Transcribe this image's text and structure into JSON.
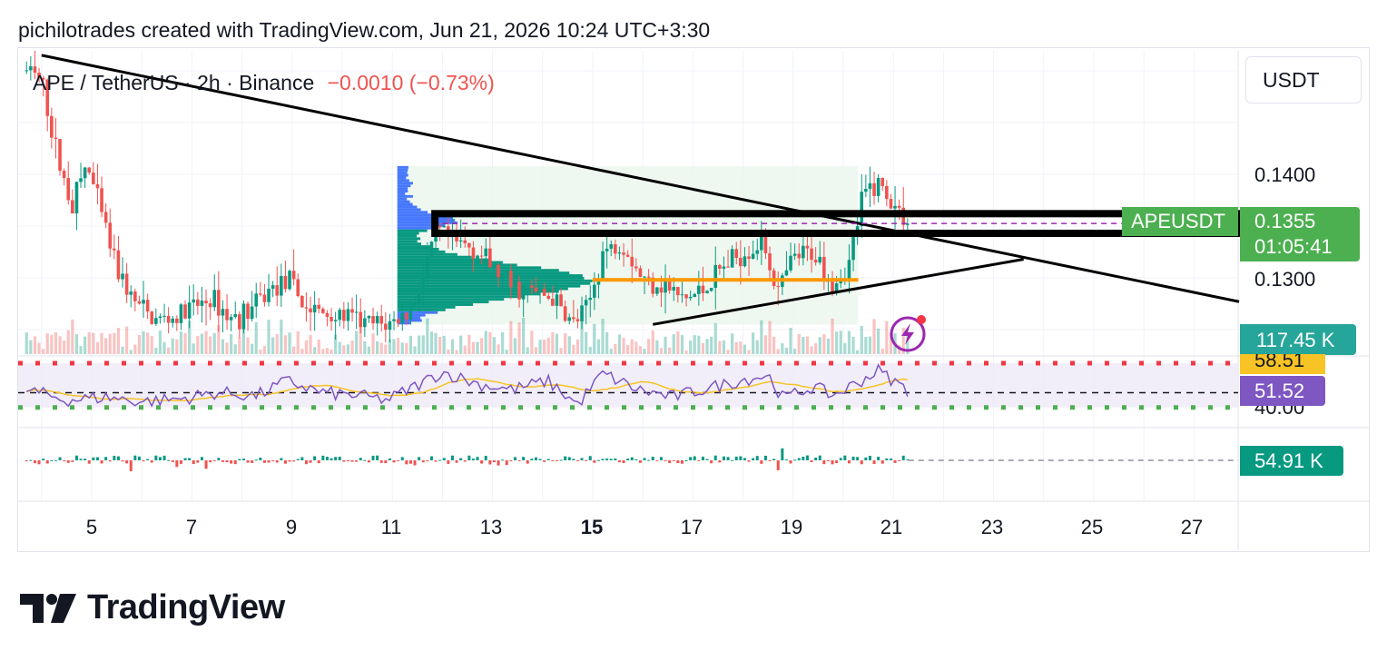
{
  "attribution": "pichilotrades created with TradingView.com, Jun 21, 2026 10:24 UTC+3:30",
  "header": {
    "symbol": "APE / TetherUS · 2h · Binance",
    "change": "−0.0010 (−0.73%)",
    "currency": "USDT"
  },
  "price_axis": {
    "ticks": [
      "0.1400",
      "0.1300"
    ]
  },
  "tags": {
    "ticker_label": "APEUSDT",
    "last_price": "0.1355",
    "countdown": "01:05:41",
    "volume": "117.45 K",
    "rsi_ma": "58.51",
    "rsi": "51.52",
    "rsi_level": "40.00",
    "oscillator": "54.91 K"
  },
  "x_axis": {
    "labels": [
      "5",
      "7",
      "9",
      "11",
      "13",
      "15",
      "17",
      "19",
      "21",
      "23",
      "25",
      "27"
    ],
    "bold_label": "15"
  },
  "logo_text": "TradingView",
  "colors": {
    "up": "#089981",
    "down": "#ef5350",
    "rsi_line": "#7e57c2",
    "rsi_ma": "#f7c325",
    "profile_blue": "#2962ff",
    "profile_green": "#089981",
    "poc_orange": "#ff9800",
    "last_price_tag": "#4caf50",
    "volume_tag": "#26a69a"
  },
  "chart_data": {
    "type": "candlestick",
    "symbol": "APE / TetherUS",
    "interval": "2h",
    "exchange": "Binance",
    "price_range": [
      0.1245,
      0.1515
    ],
    "last_price": 0.1355,
    "x_range_days": [
      3.7,
      27.9
    ],
    "price_path": [
      {
        "day": 3.7,
        "price": 0.15
      },
      {
        "day": 4.0,
        "price": 0.149
      },
      {
        "day": 4.3,
        "price": 0.142
      },
      {
        "day": 4.6,
        "price": 0.137
      },
      {
        "day": 4.9,
        "price": 0.141
      },
      {
        "day": 5.2,
        "price": 0.136
      },
      {
        "day": 5.5,
        "price": 0.131
      },
      {
        "day": 5.8,
        "price": 0.128
      },
      {
        "day": 6.2,
        "price": 0.126
      },
      {
        "day": 6.6,
        "price": 0.126
      },
      {
        "day": 7.0,
        "price": 0.127
      },
      {
        "day": 7.4,
        "price": 0.128
      },
      {
        "day": 7.8,
        "price": 0.126
      },
      {
        "day": 8.2,
        "price": 0.127
      },
      {
        "day": 8.6,
        "price": 0.129
      },
      {
        "day": 8.9,
        "price": 0.1298
      },
      {
        "day": 9.3,
        "price": 0.127
      },
      {
        "day": 9.7,
        "price": 0.1265
      },
      {
        "day": 10.1,
        "price": 0.1262
      },
      {
        "day": 10.5,
        "price": 0.1255
      },
      {
        "day": 10.9,
        "price": 0.1255
      },
      {
        "day": 11.3,
        "price": 0.1265
      },
      {
        "day": 11.6,
        "price": 0.1298
      },
      {
        "day": 11.9,
        "price": 0.1345
      },
      {
        "day": 12.2,
        "price": 0.1334
      },
      {
        "day": 12.6,
        "price": 0.133
      },
      {
        "day": 13.0,
        "price": 0.131
      },
      {
        "day": 13.4,
        "price": 0.129
      },
      {
        "day": 13.8,
        "price": 0.1287
      },
      {
        "day": 14.2,
        "price": 0.128
      },
      {
        "day": 14.6,
        "price": 0.1255
      },
      {
        "day": 14.9,
        "price": 0.127
      },
      {
        "day": 15.2,
        "price": 0.1325
      },
      {
        "day": 15.6,
        "price": 0.1335
      },
      {
        "day": 16.0,
        "price": 0.1298
      },
      {
        "day": 16.4,
        "price": 0.1295
      },
      {
        "day": 16.8,
        "price": 0.1278
      },
      {
        "day": 17.2,
        "price": 0.1288
      },
      {
        "day": 17.6,
        "price": 0.131
      },
      {
        "day": 18.0,
        "price": 0.1325
      },
      {
        "day": 18.4,
        "price": 0.1335
      },
      {
        "day": 18.7,
        "price": 0.1285
      },
      {
        "day": 19.0,
        "price": 0.1318
      },
      {
        "day": 19.4,
        "price": 0.1325
      },
      {
        "day": 19.8,
        "price": 0.1295
      },
      {
        "day": 20.1,
        "price": 0.131
      },
      {
        "day": 20.4,
        "price": 0.138
      },
      {
        "day": 20.7,
        "price": 0.1393
      },
      {
        "day": 21.0,
        "price": 0.137
      },
      {
        "day": 21.3,
        "price": 0.1355
      }
    ],
    "volume_profile": {
      "day_range": [
        11.1,
        20.3
      ],
      "price_range": [
        0.1255,
        0.1408
      ],
      "value_area": [
        0.1268,
        0.1348
      ],
      "poc_price": 0.1297
    },
    "annotations": {
      "descending_trendline": [
        {
          "day": 4.0,
          "price": 0.1515
        },
        {
          "day": 27.9,
          "price": 0.1277
        }
      ],
      "ascending_trendline": [
        {
          "day": 16.2,
          "price": 0.1255
        },
        {
          "day": 23.6,
          "price": 0.1318
        }
      ],
      "resistance_box": [
        0.1343,
        0.1362
      ],
      "support_line": 0.1298
    },
    "rsi": {
      "current": 51.52,
      "ma": 58.51,
      "bands": [
        40.0,
        70.0
      ],
      "path": [
        {
          "day": 3.7,
          "value": 52
        },
        {
          "day": 4.5,
          "value": 45
        },
        {
          "day": 5.3,
          "value": 47
        },
        {
          "day": 6.0,
          "value": 44
        },
        {
          "day": 6.8,
          "value": 46
        },
        {
          "day": 7.5,
          "value": 50
        },
        {
          "day": 8.3,
          "value": 48
        },
        {
          "day": 8.9,
          "value": 58
        },
        {
          "day": 9.6,
          "value": 50
        },
        {
          "day": 10.3,
          "value": 48
        },
        {
          "day": 10.9,
          "value": 45
        },
        {
          "day": 11.5,
          "value": 55
        },
        {
          "day": 12.0,
          "value": 64
        },
        {
          "day": 12.7,
          "value": 56
        },
        {
          "day": 13.4,
          "value": 52
        },
        {
          "day": 14.1,
          "value": 58
        },
        {
          "day": 14.7,
          "value": 42
        },
        {
          "day": 15.2,
          "value": 63
        },
        {
          "day": 15.9,
          "value": 52
        },
        {
          "day": 16.6,
          "value": 47
        },
        {
          "day": 17.3,
          "value": 53
        },
        {
          "day": 17.9,
          "value": 58
        },
        {
          "day": 18.5,
          "value": 62
        },
        {
          "day": 18.8,
          "value": 46
        },
        {
          "day": 19.4,
          "value": 54
        },
        {
          "day": 19.8,
          "value": 48
        },
        {
          "day": 20.3,
          "value": 57
        },
        {
          "day": 20.7,
          "value": 65
        },
        {
          "day": 21.0,
          "value": 58
        },
        {
          "day": 21.3,
          "value": 51.5
        }
      ]
    },
    "oscillator_last": "54.91 K"
  }
}
